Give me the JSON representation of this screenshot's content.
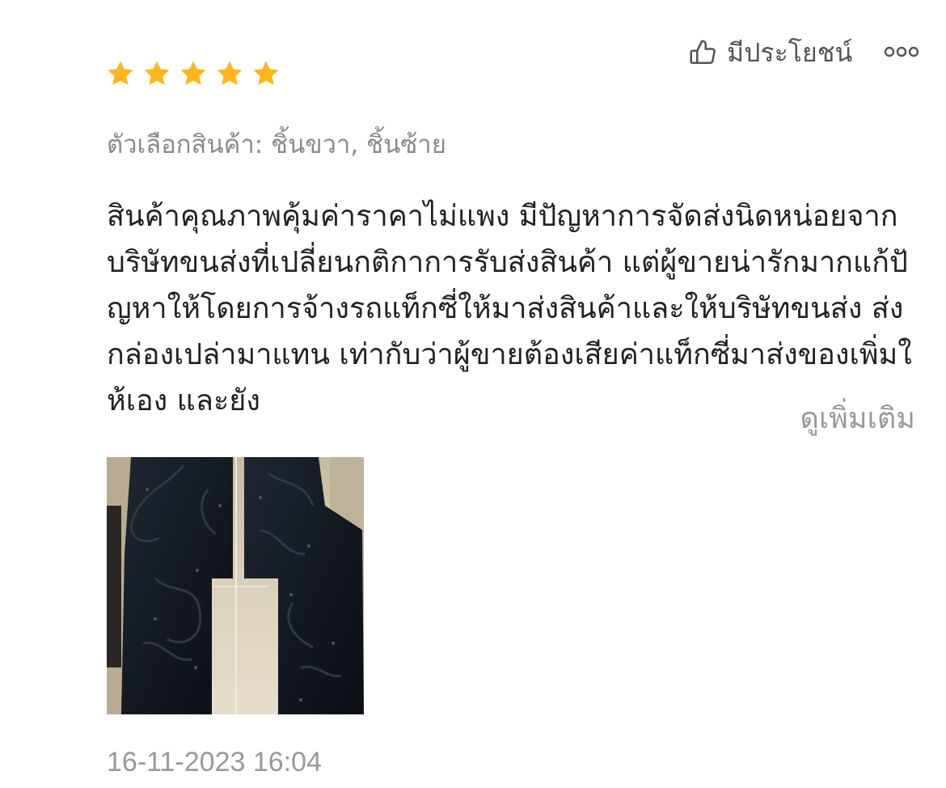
{
  "review": {
    "rating": 5,
    "rating_max": 5,
    "star_color": "#FFB61E",
    "variation_label": "ตัวเลือกสินค้า:",
    "variation_value": "ชิ้นขวา, ชิ้นซ้าย",
    "text": "สินค้าคุณภาพคุ้มค่าราคาไม่แพง มีปัญหาการจัดส่งนิดหน่อยจากบริษัทขนส่งที่เปลี่ยนกติกาการรับส่งสินค้า แต่ผู้ขายน่ารักมากแก้ปัญหาให้โดยการจ้างรถแท็กซี่ให้มาส่งสินค้าและให้บริษัทขนส่ง ส่งกล่องเปล่ามาแทน เท่ากับว่าผู้ขายต้องเสียค่าแท็กซี่มาส่งของเพิ่มให้เอง และยัง",
    "see_more_label": "ดูเพิ่มเติม",
    "timestamp": "16-11-2023 16:04"
  },
  "actions": {
    "helpful_label": "มีประโยชน์",
    "helpful_icon": "thumbs-up-icon",
    "more_icon": "more-options-icon"
  },
  "photo": {
    "icon": "review-photo",
    "content": "two black rubber car floor mats on a tiled floor"
  }
}
